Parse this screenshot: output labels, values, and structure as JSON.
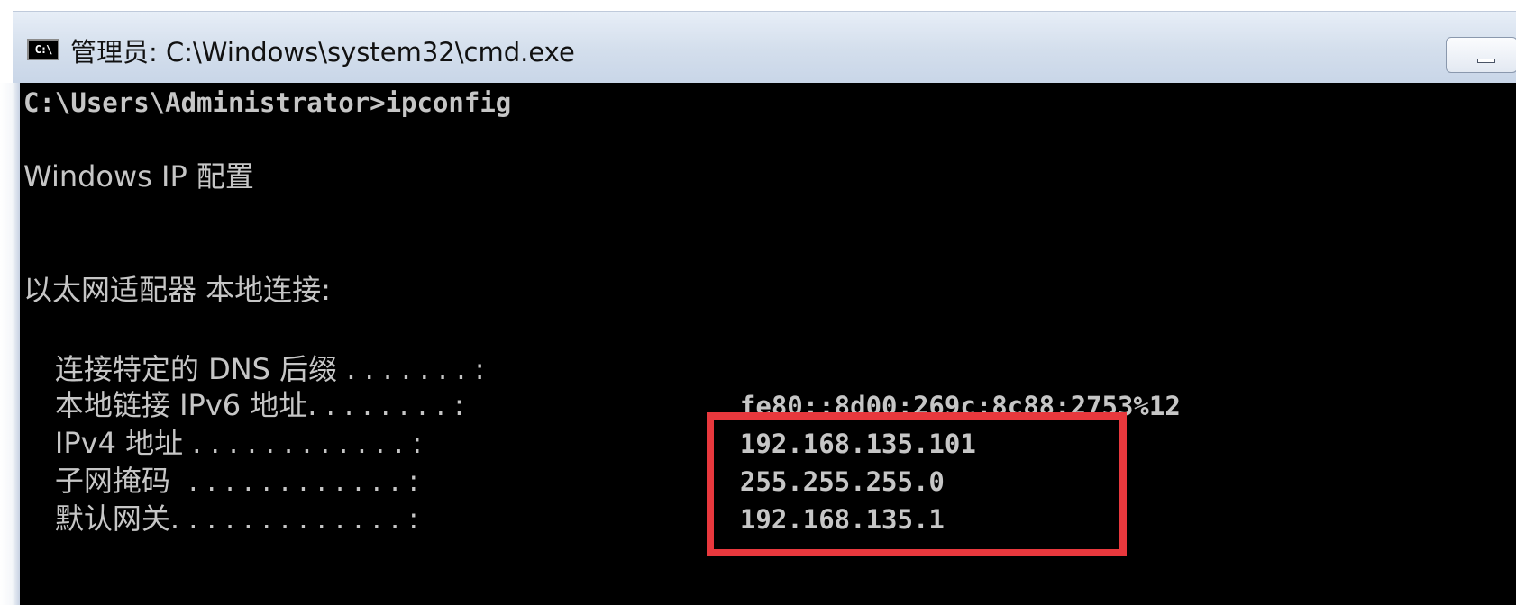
{
  "window": {
    "title": "管理员: C:\\Windows\\system32\\cmd.exe",
    "icon": "cmd-icon",
    "icon_text": "C:\\"
  },
  "console": {
    "prompt_line": "C:\\Users\\Administrator>ipconfig",
    "heading": "Windows IP 配置",
    "adapter": "以太网适配器 本地连接:",
    "entries": [
      {
        "label": "连接特定的 DNS 后缀 . . . . . . . :",
        "value": ""
      },
      {
        "label": "本地链接 IPv6 地址. . . . . . . . :",
        "value": "fe80::8d00:269c:8c88:2753%12"
      },
      {
        "label": "IPv4 地址 . . . . . . . . . . . . :",
        "value": "192.168.135.101"
      },
      {
        "label": "子网掩码  . . . . . . . . . . . . :",
        "value": "255.255.255.0"
      },
      {
        "label": "默认网关. . . . . . . . . . . . . :",
        "value": "192.168.135.1"
      }
    ]
  },
  "colors": {
    "console_text": "#c6c6c6",
    "console_bg": "#000000",
    "highlight": "#e8383d"
  }
}
